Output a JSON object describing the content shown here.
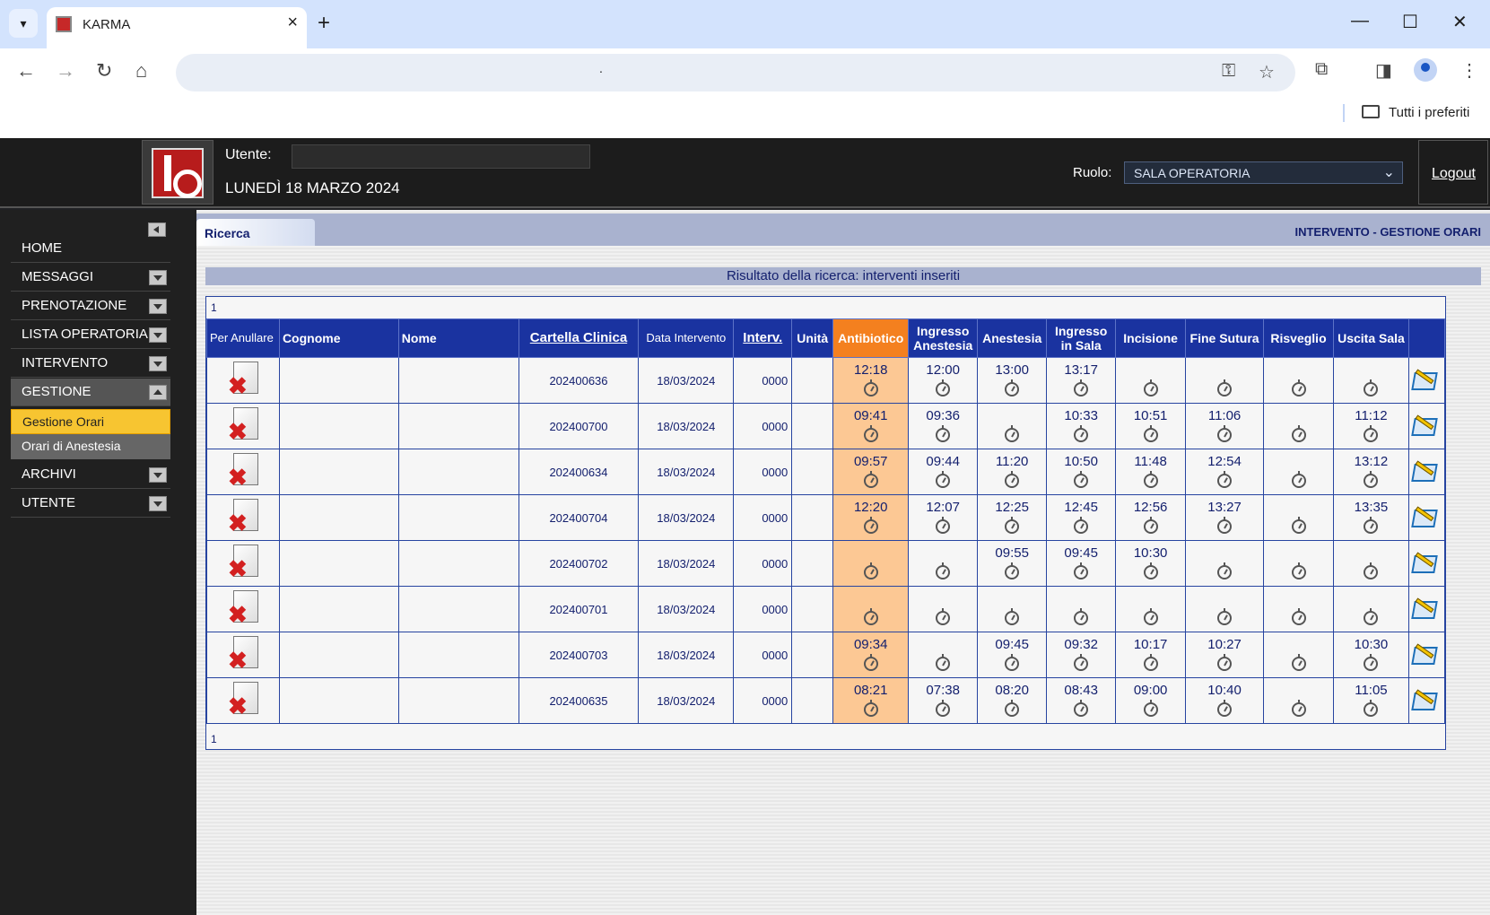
{
  "browser": {
    "tab_title": "KARMA",
    "address_text": ".",
    "bookmarks_label": "Tutti i preferiti"
  },
  "header": {
    "user_label": "Utente:",
    "user_value": "",
    "date": "LUNEDÌ 18 MARZO 2024",
    "role_label": "Ruolo:",
    "role_value": "SALA OPERATORIA",
    "logout": "Logout"
  },
  "sidebar": {
    "items": [
      {
        "label": "HOME",
        "has_arrow": false
      },
      {
        "label": "MESSAGGI",
        "has_arrow": true
      },
      {
        "label": "PRENOTAZIONE",
        "has_arrow": true
      },
      {
        "label": "LISTA OPERATORIA",
        "has_arrow": true
      },
      {
        "label": "INTERVENTO",
        "has_arrow": true
      },
      {
        "label": "GESTIONE",
        "has_arrow": true,
        "expanded": true
      },
      {
        "label": "ARCHIVI",
        "has_arrow": true
      },
      {
        "label": "UTENTE",
        "has_arrow": true
      }
    ],
    "subitems": [
      {
        "label": "Gestione Orari",
        "selected": true
      },
      {
        "label": "Orari di Anestesia",
        "selected": false
      }
    ]
  },
  "main": {
    "tab_label": "Ricerca",
    "section_title": "INTERVENTO  -  GESTIONE ORARI",
    "result_banner": "Risultato della ricerca: interventi inseriti",
    "pager_top": "1",
    "pager_bottom": "1",
    "columns": [
      {
        "label": "Per Anullare"
      },
      {
        "label": "Cognome"
      },
      {
        "label": "Nome"
      },
      {
        "label": "Cartella Clinica"
      },
      {
        "label": "Data Intervento"
      },
      {
        "label": "Interv."
      },
      {
        "label": "Unità"
      },
      {
        "label": "Antibiotico"
      },
      {
        "label": "Ingresso Anestesia"
      },
      {
        "label": "Anestesia"
      },
      {
        "label": "Ingresso in Sala"
      },
      {
        "label": "Incisione"
      },
      {
        "label": "Fine Sutura"
      },
      {
        "label": "Risveglio"
      },
      {
        "label": "Uscita Sala"
      },
      {
        "label": ""
      }
    ],
    "rows": [
      {
        "cognome": "",
        "nome": "",
        "cartella": "202400636",
        "data": "18/03/2024",
        "interv": "0000",
        "unita": "",
        "times": [
          "12:18",
          "12:00",
          "13:00",
          "13:17",
          "",
          "",
          "",
          ""
        ]
      },
      {
        "cognome": "",
        "nome": "",
        "cartella": "202400700",
        "data": "18/03/2024",
        "interv": "0000",
        "unita": "",
        "times": [
          "09:41",
          "09:36",
          "",
          "10:33",
          "10:51",
          "11:06",
          "",
          "11:12"
        ]
      },
      {
        "cognome": "",
        "nome": "",
        "cartella": "202400634",
        "data": "18/03/2024",
        "interv": "0000",
        "unita": "",
        "times": [
          "09:57",
          "09:44",
          "11:20",
          "10:50",
          "11:48",
          "12:54",
          "",
          "13:12"
        ]
      },
      {
        "cognome": "",
        "nome": "",
        "cartella": "202400704",
        "data": "18/03/2024",
        "interv": "0000",
        "unita": "",
        "times": [
          "12:20",
          "12:07",
          "12:25",
          "12:45",
          "12:56",
          "13:27",
          "",
          "13:35"
        ]
      },
      {
        "cognome": "",
        "nome": "",
        "cartella": "202400702",
        "data": "18/03/2024",
        "interv": "0000",
        "unita": "",
        "times": [
          "",
          "",
          "09:55",
          "09:45",
          "10:30",
          "",
          "",
          ""
        ]
      },
      {
        "cognome": "",
        "nome": "",
        "cartella": "202400701",
        "data": "18/03/2024",
        "interv": "0000",
        "unita": "",
        "times": [
          "",
          "",
          "",
          "",
          "",
          "",
          "",
          ""
        ]
      },
      {
        "cognome": "",
        "nome": "",
        "cartella": "202400703",
        "data": "18/03/2024",
        "interv": "0000",
        "unita": "",
        "times": [
          "09:34",
          "",
          "09:45",
          "09:32",
          "10:17",
          "10:27",
          "",
          "10:30"
        ]
      },
      {
        "cognome": "",
        "nome": "",
        "cartella": "202400635",
        "data": "18/03/2024",
        "interv": "0000",
        "unita": "",
        "times": [
          "08:21",
          "07:38",
          "08:20",
          "08:43",
          "09:00",
          "10:40",
          "",
          "11:05"
        ]
      }
    ]
  },
  "colors": {
    "header_blue": "#1a33a0",
    "antibiotico_header": "#f4801f",
    "antibiotico_cell": "#fcc894",
    "selected_menu": "#f7c531",
    "text_navy": "#14206e"
  }
}
